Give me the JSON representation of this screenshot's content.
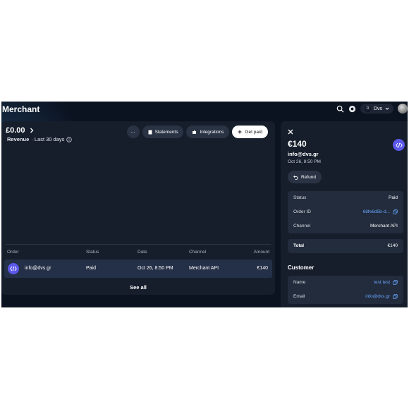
{
  "app": {
    "title": "Merchant"
  },
  "topbar": {
    "account_initial": "D",
    "account_name": "Dvs"
  },
  "revenue": {
    "amount": "£0.00",
    "label": "Revenue",
    "period": "· Last 30 days"
  },
  "actions": {
    "more": "···",
    "statements": "Statements",
    "integrations": "Integrations",
    "get_paid": "Get paid"
  },
  "table": {
    "headers": [
      "Order",
      "Status",
      "Date",
      "Channel",
      "Amount"
    ],
    "rows": [
      {
        "order": "info@dvs.gr",
        "status": "Paid",
        "date": "Oct 26, 8:50 PM",
        "channel": "Merchant API",
        "amount": "€140"
      }
    ],
    "see_all": "See all"
  },
  "detail": {
    "price": "€140",
    "email": "info@dvs.gr",
    "date": "Oct 26, 8:50 PM",
    "refund": "Refund",
    "summary": [
      {
        "label": "Status",
        "value": "Paid"
      },
      {
        "label": "Order ID",
        "value": "68fe6d5b-d..."
      },
      {
        "label": "Channel",
        "value": "Merchant API"
      }
    ],
    "total_label": "Total",
    "total_value": "€140",
    "customer_title": "Customer",
    "customer": [
      {
        "label": "Name",
        "value": "test test"
      },
      {
        "label": "Email",
        "value": "info@dvs.gr"
      }
    ]
  },
  "colors": {
    "accent": "#5b57e8",
    "link": "#6aa4ff",
    "background": "#0b1220",
    "card": "#161e2c"
  }
}
